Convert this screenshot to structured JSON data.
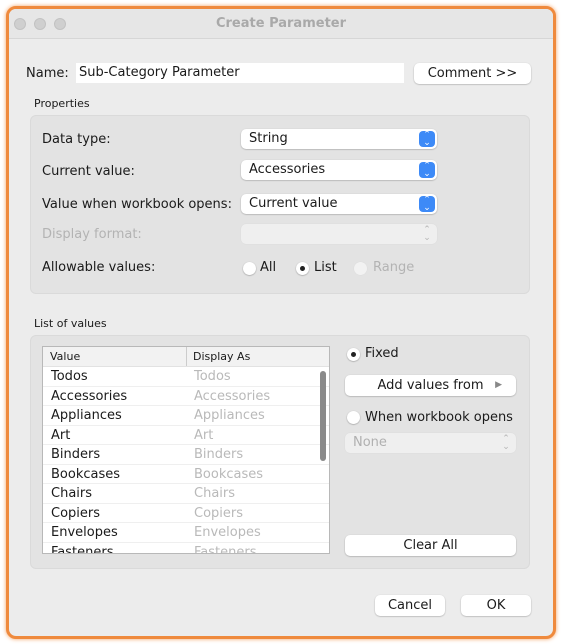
{
  "window": {
    "title": "Create Parameter"
  },
  "name": {
    "label": "Name:",
    "value": "Sub-Category Parameter",
    "comment_button": "Comment >>"
  },
  "properties": {
    "heading": "Properties",
    "data_type": {
      "label": "Data type:",
      "value": "String"
    },
    "current_value": {
      "label": "Current value:",
      "value": "Accessories"
    },
    "value_when_opens": {
      "label": "Value when workbook opens:",
      "value": "Current value"
    },
    "display_format": {
      "label": "Display format:",
      "value": ""
    },
    "allowable_values": {
      "label": "Allowable values:",
      "options": [
        "All",
        "List",
        "Range"
      ],
      "selected": "List"
    }
  },
  "list": {
    "heading": "List of values",
    "columns": [
      "Value",
      "Display As"
    ],
    "rows": [
      {
        "value": "Todos",
        "display": "Todos"
      },
      {
        "value": "Accessories",
        "display": "Accessories"
      },
      {
        "value": "Appliances",
        "display": "Appliances"
      },
      {
        "value": "Art",
        "display": "Art"
      },
      {
        "value": "Binders",
        "display": "Binders"
      },
      {
        "value": "Bookcases",
        "display": "Bookcases"
      },
      {
        "value": "Chairs",
        "display": "Chairs"
      },
      {
        "value": "Copiers",
        "display": "Copiers"
      },
      {
        "value": "Envelopes",
        "display": "Envelopes"
      },
      {
        "value": "Fasteners",
        "display": "Fasteners"
      }
    ],
    "fixed_label": "Fixed",
    "add_values_label": "Add values from",
    "when_opens_label": "When workbook opens",
    "when_opens_select": "None",
    "clear_all": "Clear All"
  },
  "footer": {
    "cancel": "Cancel",
    "ok": "OK"
  },
  "colors": {
    "accent": "#3d8af7",
    "highlight_border": "#ef8a3d"
  }
}
